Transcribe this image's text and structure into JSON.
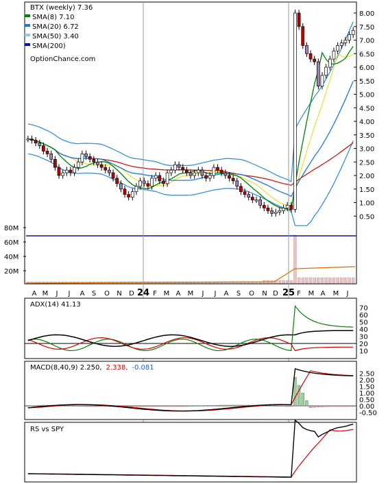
{
  "chart_data": [
    {
      "type": "candlestick",
      "symbol_label": "BTX (weekly) 7.36",
      "watermark": "OptionChance.com",
      "legend": [
        {
          "name": "SMA(8) 7.10",
          "color": "#008000"
        },
        {
          "name": "SMA(20) 6.72",
          "color": "#1e78d6"
        },
        {
          "name": "SMA(50) 3.40",
          "color": "#8ec9f2"
        },
        {
          "name": "SMA(200)",
          "color": "#1010a0"
        }
      ],
      "x_ticks": [
        "A",
        "M",
        "J",
        "J",
        "A",
        "S",
        "O",
        "N",
        "D",
        "24",
        "F",
        "M",
        "A",
        "M",
        "J",
        "J",
        "A",
        "S",
        "O",
        "N",
        "D",
        "25",
        "F",
        "M",
        "A",
        "M",
        "J"
      ],
      "y_ticks": [
        "8.00",
        "7.50",
        "7.00",
        "6.50",
        "6.00",
        "5.50",
        "5.00",
        "4.50",
        "4.00",
        "3.50",
        "3.00",
        "2.50",
        "2.00",
        "1.50",
        "1.00",
        "0.50"
      ],
      "ylim": [
        0.0,
        8.3
      ],
      "volume_ticks": [
        "80M",
        "60M",
        "40M",
        "20M"
      ],
      "close": [
        3.35,
        3.3,
        3.2,
        3.1,
        2.9,
        2.8,
        2.6,
        2.3,
        2.0,
        2.1,
        2.2,
        2.1,
        2.3,
        2.5,
        2.8,
        2.7,
        2.6,
        2.5,
        2.4,
        2.3,
        2.2,
        2.1,
        1.9,
        1.7,
        1.5,
        1.3,
        1.2,
        1.4,
        1.6,
        1.8,
        1.7,
        1.6,
        1.9,
        2.0,
        1.8,
        1.7,
        2.1,
        2.2,
        2.4,
        2.3,
        2.2,
        2.1,
        2.0,
        2.1,
        2.2,
        2.0,
        1.9,
        2.0,
        2.3,
        2.2,
        2.1,
        2.0,
        1.9,
        1.8,
        1.6,
        1.4,
        1.3,
        1.2,
        1.1,
        1.1,
        0.9,
        0.8,
        0.7,
        0.6,
        0.65,
        0.7,
        0.8,
        0.9,
        0.75,
        8.0,
        7.5,
        6.8,
        6.5,
        6.3,
        6.2,
        5.3,
        5.7,
        6.0,
        6.3,
        6.6,
        6.8,
        6.9,
        7.0,
        7.2,
        7.36
      ]
    },
    {
      "type": "line",
      "label": "ADX(14) 41.13",
      "y_ticks": [
        "70",
        "60",
        "50",
        "40",
        "30",
        "20",
        "10"
      ],
      "ylim": [
        0,
        80
      ]
    },
    {
      "type": "bar",
      "label": "MACD(8,40,9) 2.250,",
      "label_signal": "2.338,",
      "label_hist": "-0.081",
      "y_ticks": [
        "2.50",
        "2.00",
        "1.50",
        "1.00",
        "0.50",
        "0.00",
        "-0.50"
      ],
      "ylim": [
        -0.8,
        2.7
      ]
    },
    {
      "type": "line",
      "label": "RS vs SPY"
    }
  ]
}
